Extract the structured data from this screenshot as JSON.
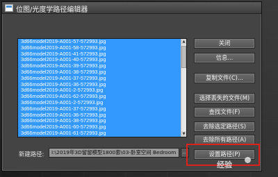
{
  "dialog": {
    "title": "位图/光度学路径编辑器"
  },
  "files": [
    "3d66model2019-A001-57-572993.jpg",
    "3d66model2019-A001-58-572993.jpg",
    "3d66model2019-A001-41-572993.jpg",
    "3d66model2019-A001-40-572993.jpg",
    "3d66model2019-A001-39-572993.jpg",
    "3d66model2019-A001-38-572993.jpg",
    "3d66model2019-A001-37-572993.jpg",
    "3d66model2019-A001-36-572993.jpg",
    "3d66model2019-A001-2-572993.jpg",
    "3d66model2019-A001-62-572993.jpg",
    "3d66model2019-A001-2-572993.jpg",
    "3d66model2019-A001-37-572993.jpg",
    "3d66model2019-A001-36-572993.jpg",
    "3d66model2019-A001-38-572993.jpg",
    "3d66model2019-A001-60-572993.jpg",
    "3d66model2019-A001-61-572993.jpg"
  ],
  "buttons": {
    "close": "关闭",
    "info": "信息...",
    "copy_files": "复制文件(C)...",
    "select_missing": "选择丢失的文件(M)",
    "find_files": "查找文件(F)",
    "strip_selected": "去除选定路径(S)",
    "strip_all": "去除所有路径(A)",
    "set_path": "设置路径(P)"
  },
  "new_path": {
    "label": "新建路径:",
    "value": "I:\\2019年3D留留模型1800套\\03-卧室空间 Bedroom",
    "browse": "..."
  },
  "watermark": {
    "text": "经验"
  }
}
